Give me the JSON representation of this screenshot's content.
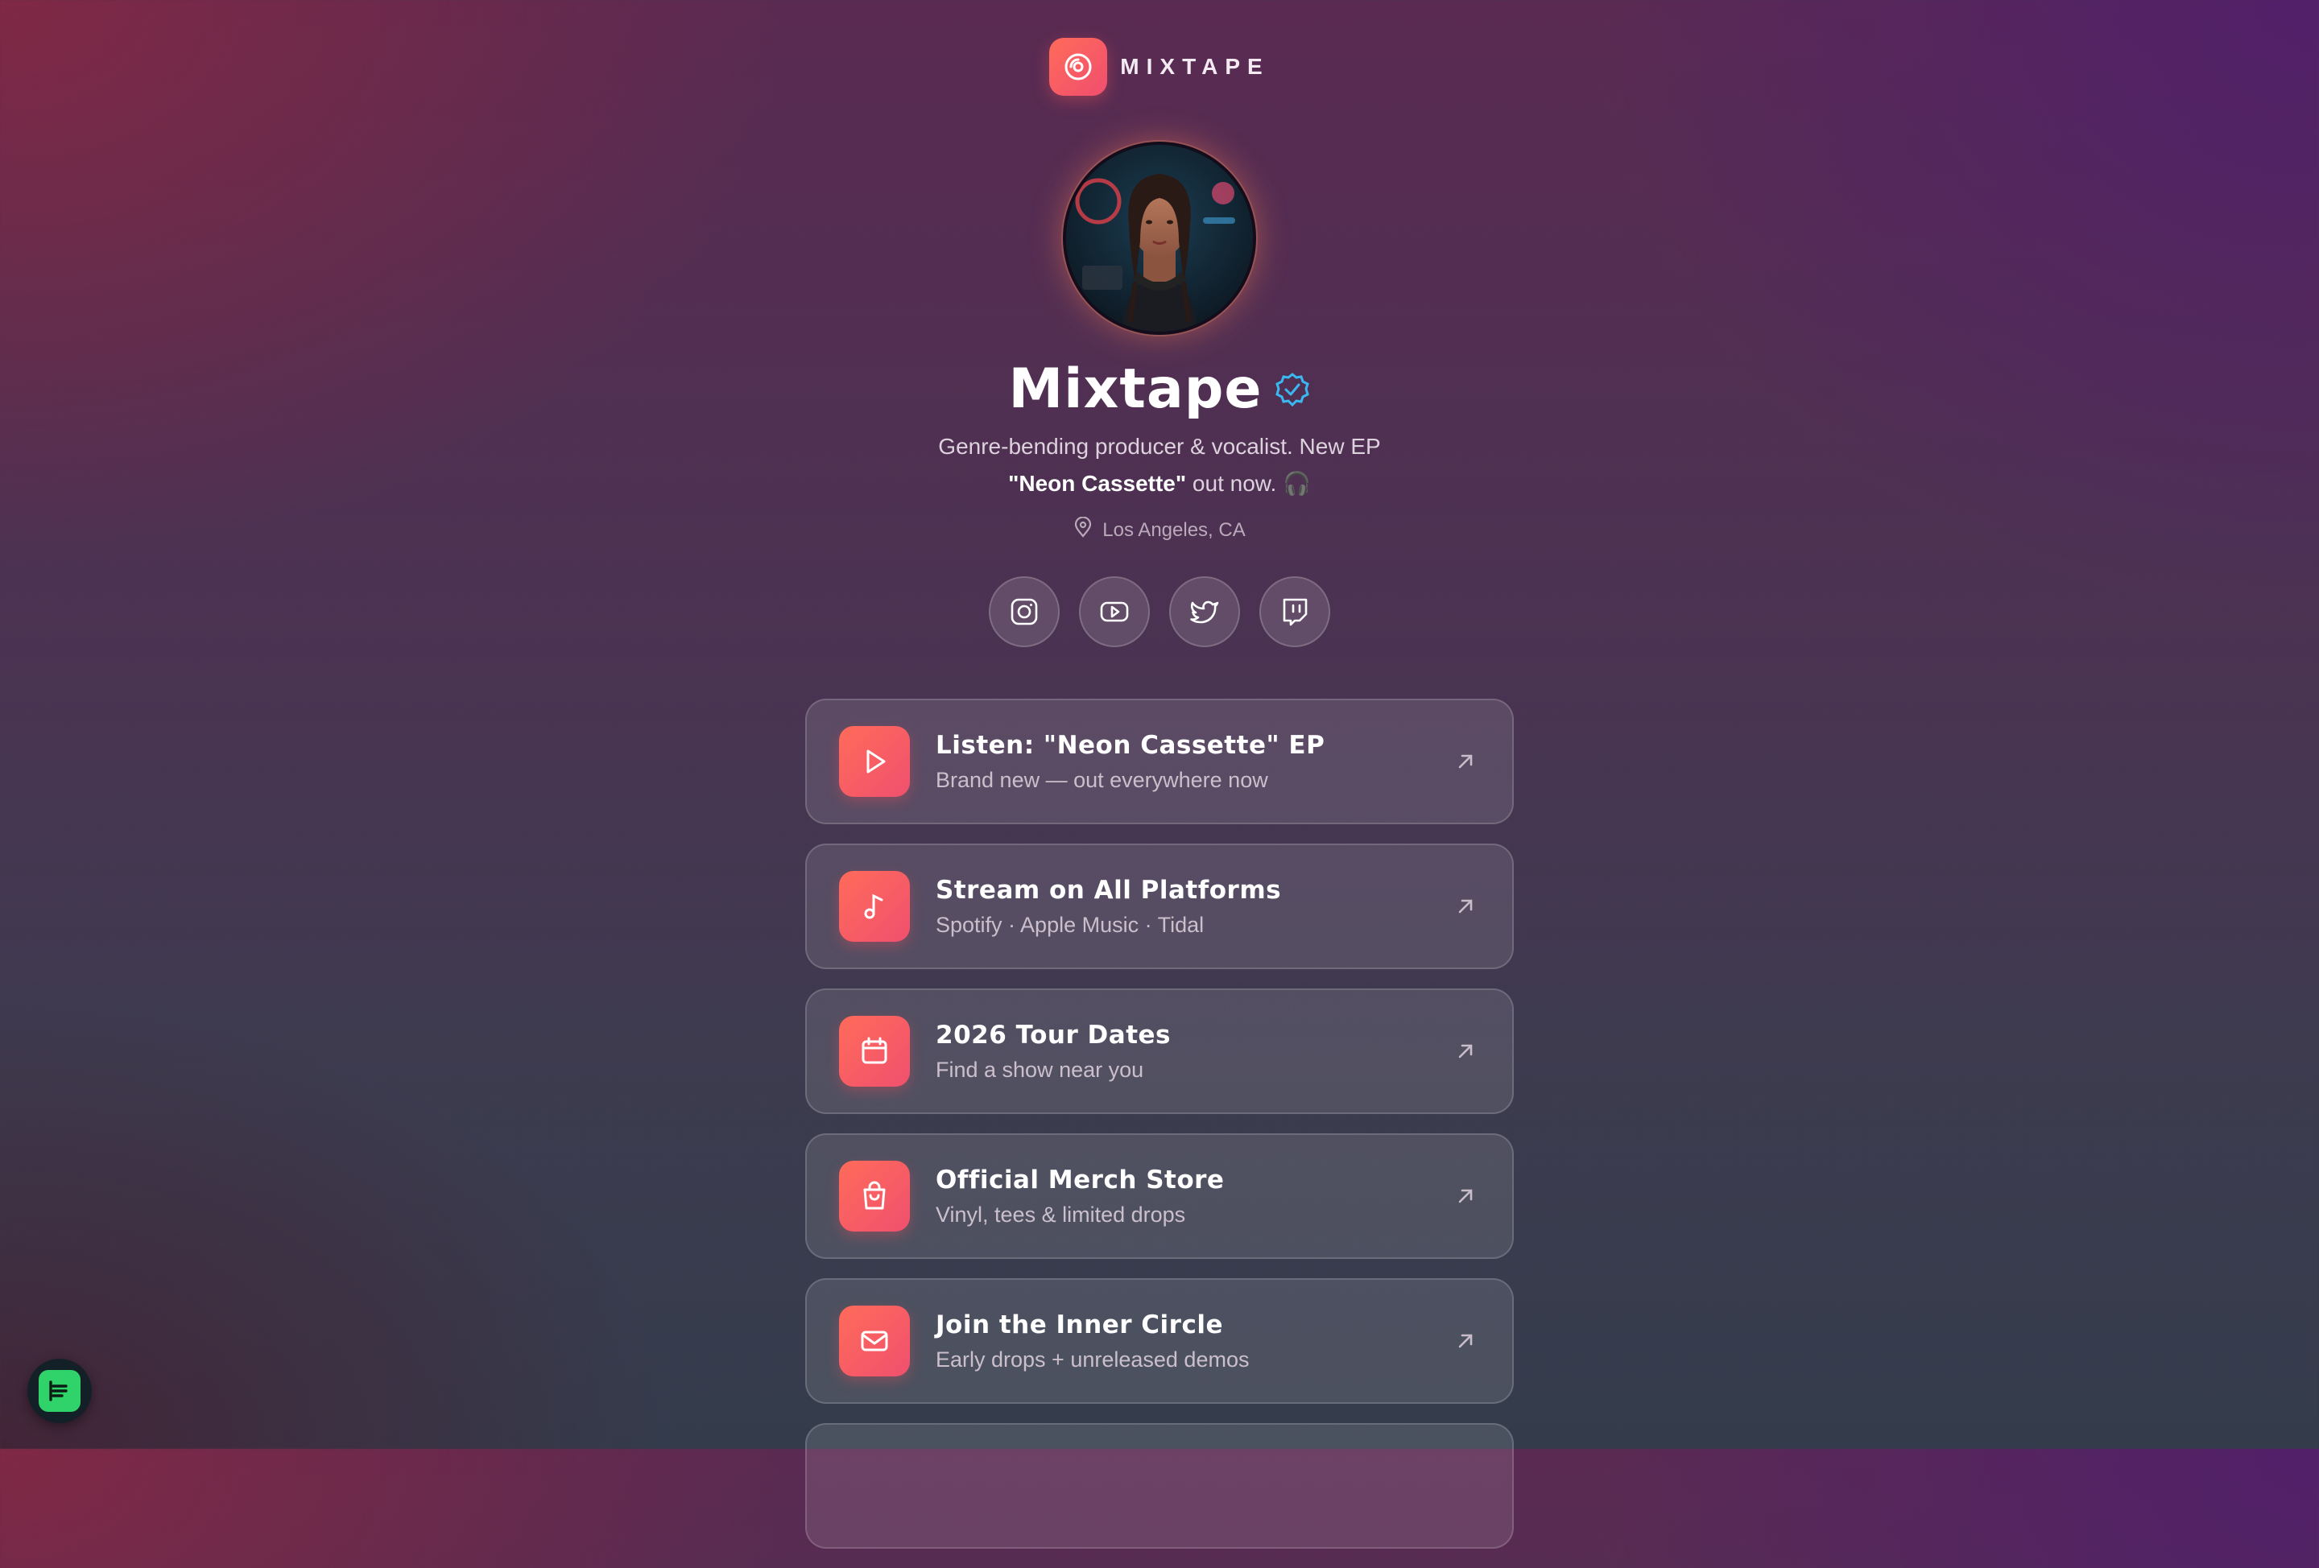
{
  "brand": {
    "name": "MIXTAPE",
    "logo_icon": "vinyl-disc-icon"
  },
  "profile": {
    "name": "Mixtape",
    "verified_icon": "verified-badge-icon",
    "bio_line1": "Genre-bending producer & vocalist. New EP",
    "bio_highlight": "\"Neon Cassette\"",
    "bio_line2_rest": " out now. 🎧",
    "location": "Los Angeles, CA",
    "location_icon": "map-pin-icon"
  },
  "socials": [
    {
      "name": "Instagram",
      "icon": "instagram-icon"
    },
    {
      "name": "YouTube",
      "icon": "youtube-icon"
    },
    {
      "name": "Twitter",
      "icon": "twitter-icon"
    },
    {
      "name": "Twitch",
      "icon": "twitch-icon"
    }
  ],
  "links": [
    {
      "title": "Listen: \"Neon Cassette\" EP",
      "subtitle": "Brand new — out everywhere now",
      "icon": "play-icon"
    },
    {
      "title": "Stream on All Platforms",
      "subtitle": "Spotify · Apple Music · Tidal",
      "icon": "music-note-icon"
    },
    {
      "title": "2026 Tour Dates",
      "subtitle": "Find a show near you",
      "icon": "calendar-icon"
    },
    {
      "title": "Official Merch Store",
      "subtitle": "Vinyl, tees & limited drops",
      "icon": "shopping-bag-icon"
    },
    {
      "title": "Join the Inner Circle",
      "subtitle": "Early drops + unreleased demos",
      "icon": "mail-icon"
    }
  ],
  "colors": {
    "accent_gradient_start": "#ff6b5a",
    "accent_gradient_end": "#f0506e",
    "verified": "#3ab8f0",
    "fab": "#2fd36a"
  }
}
